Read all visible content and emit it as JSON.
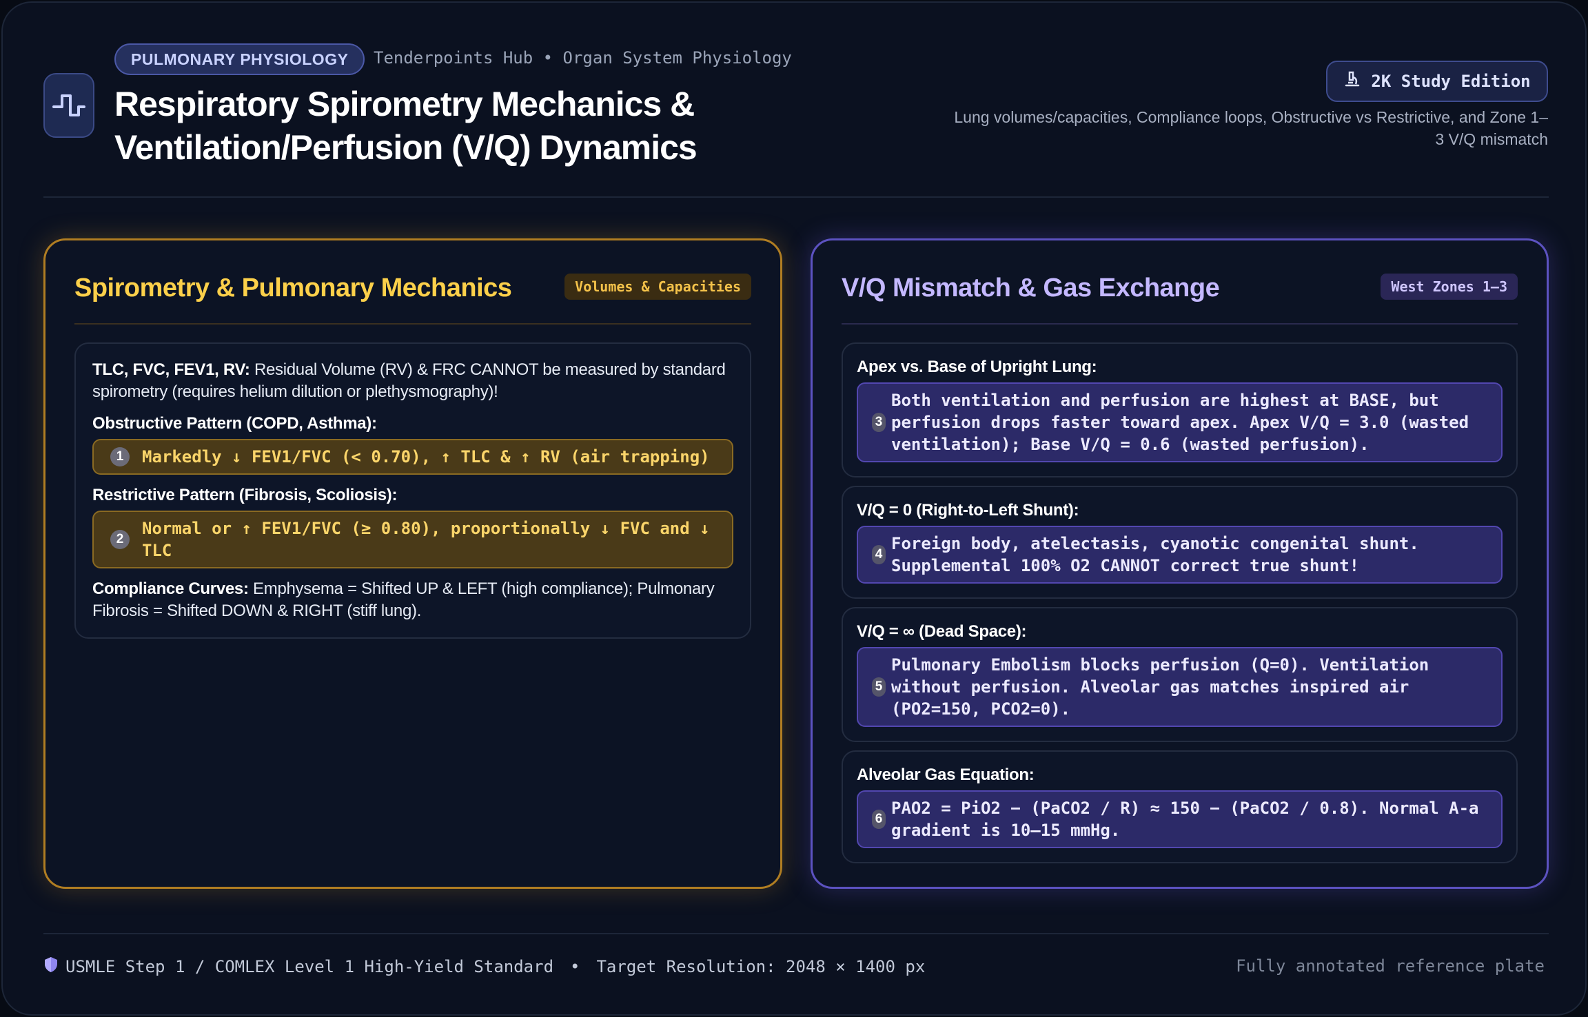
{
  "header": {
    "tag": "PULMONARY PHYSIOLOGY",
    "hub": "Tenderpoints Hub • Organ System Physiology",
    "title_line1": "Respiratory Spirometry Mechanics &",
    "title_line2": "Ventilation/Perfusion (V/Q) Dynamics",
    "edition": "2K Study Edition",
    "subtitle": "Lung volumes/capacities, Compliance loops, Obstructive vs Restrictive, and Zone 1–3 V/Q mismatch",
    "logo_icon": "pulse-wave-icon",
    "edition_icon": "microscope-icon"
  },
  "left_panel": {
    "title": "Spirometry & Pulmonary Mechanics",
    "badge": "Volumes & Capacities",
    "intro_label": "TLC, FVC, FEV1, RV:",
    "intro_text": "Residual Volume (RV) & FRC CANNOT be measured by standard spirometry (requires helium dilution or plethysmography)!",
    "obstructive_head": "Obstructive Pattern (COPD, Asthma):",
    "obstructive_num": "1",
    "obstructive_text": "Markedly ↓ FEV1/FVC (< 0.70), ↑ TLC & ↑ RV (air trapping)",
    "restrictive_head": "Restrictive Pattern (Fibrosis, Scoliosis):",
    "restrictive_num": "2",
    "restrictive_text": "Normal or ↑ FEV1/FVC (≥ 0.80), proportionally ↓ FVC and ↓ TLC",
    "compliance_label": "Compliance Curves:",
    "compliance_text": "Emphysema = Shifted UP & LEFT (high compliance); Pulmonary Fibrosis = Shifted DOWN & RIGHT (stiff lung)."
  },
  "right_panel": {
    "title": "V/Q Mismatch & Gas Exchange",
    "badge": "West Zones 1–3",
    "cards": [
      {
        "head": "Apex vs. Base of Upright Lung:",
        "num": "3",
        "text": "Both ventilation and perfusion are highest at BASE, but perfusion drops faster toward apex. Apex V/Q = 3.0 (wasted ventilation); Base V/Q = 0.6 (wasted perfusion)."
      },
      {
        "head": "V/Q = 0 (Right-to-Left Shunt):",
        "num": "4",
        "text": "Foreign body, atelectasis, cyanotic congenital shunt. Supplemental 100% O2 CANNOT correct true shunt!"
      },
      {
        "head": "V/Q = ∞ (Dead Space):",
        "num": "5",
        "text": "Pulmonary Embolism blocks perfusion (Q=0). Ventilation without perfusion. Alveolar gas matches inspired air (PO2=150, PCO2=0)."
      },
      {
        "head": "Alveolar Gas Equation:",
        "num": "6",
        "text": "PAO2 = PiO2 − (PaCO2 / R) ≈ 150 − (PaCO2 / 0.8). Normal A-a gradient is 10–15 mmHg."
      }
    ]
  },
  "footer": {
    "standard": "USMLE Step 1 / COMLEX Level 1 High-Yield Standard",
    "separator": "•",
    "resolution": "Target Resolution: 2048 × 1400 px",
    "right": "Fully annotated reference plate",
    "shield_icon": "shield-icon"
  },
  "colors": {
    "amber_accent": "#fcd04a",
    "violet_accent": "#c4b8ff",
    "background": "#0b1120"
  }
}
